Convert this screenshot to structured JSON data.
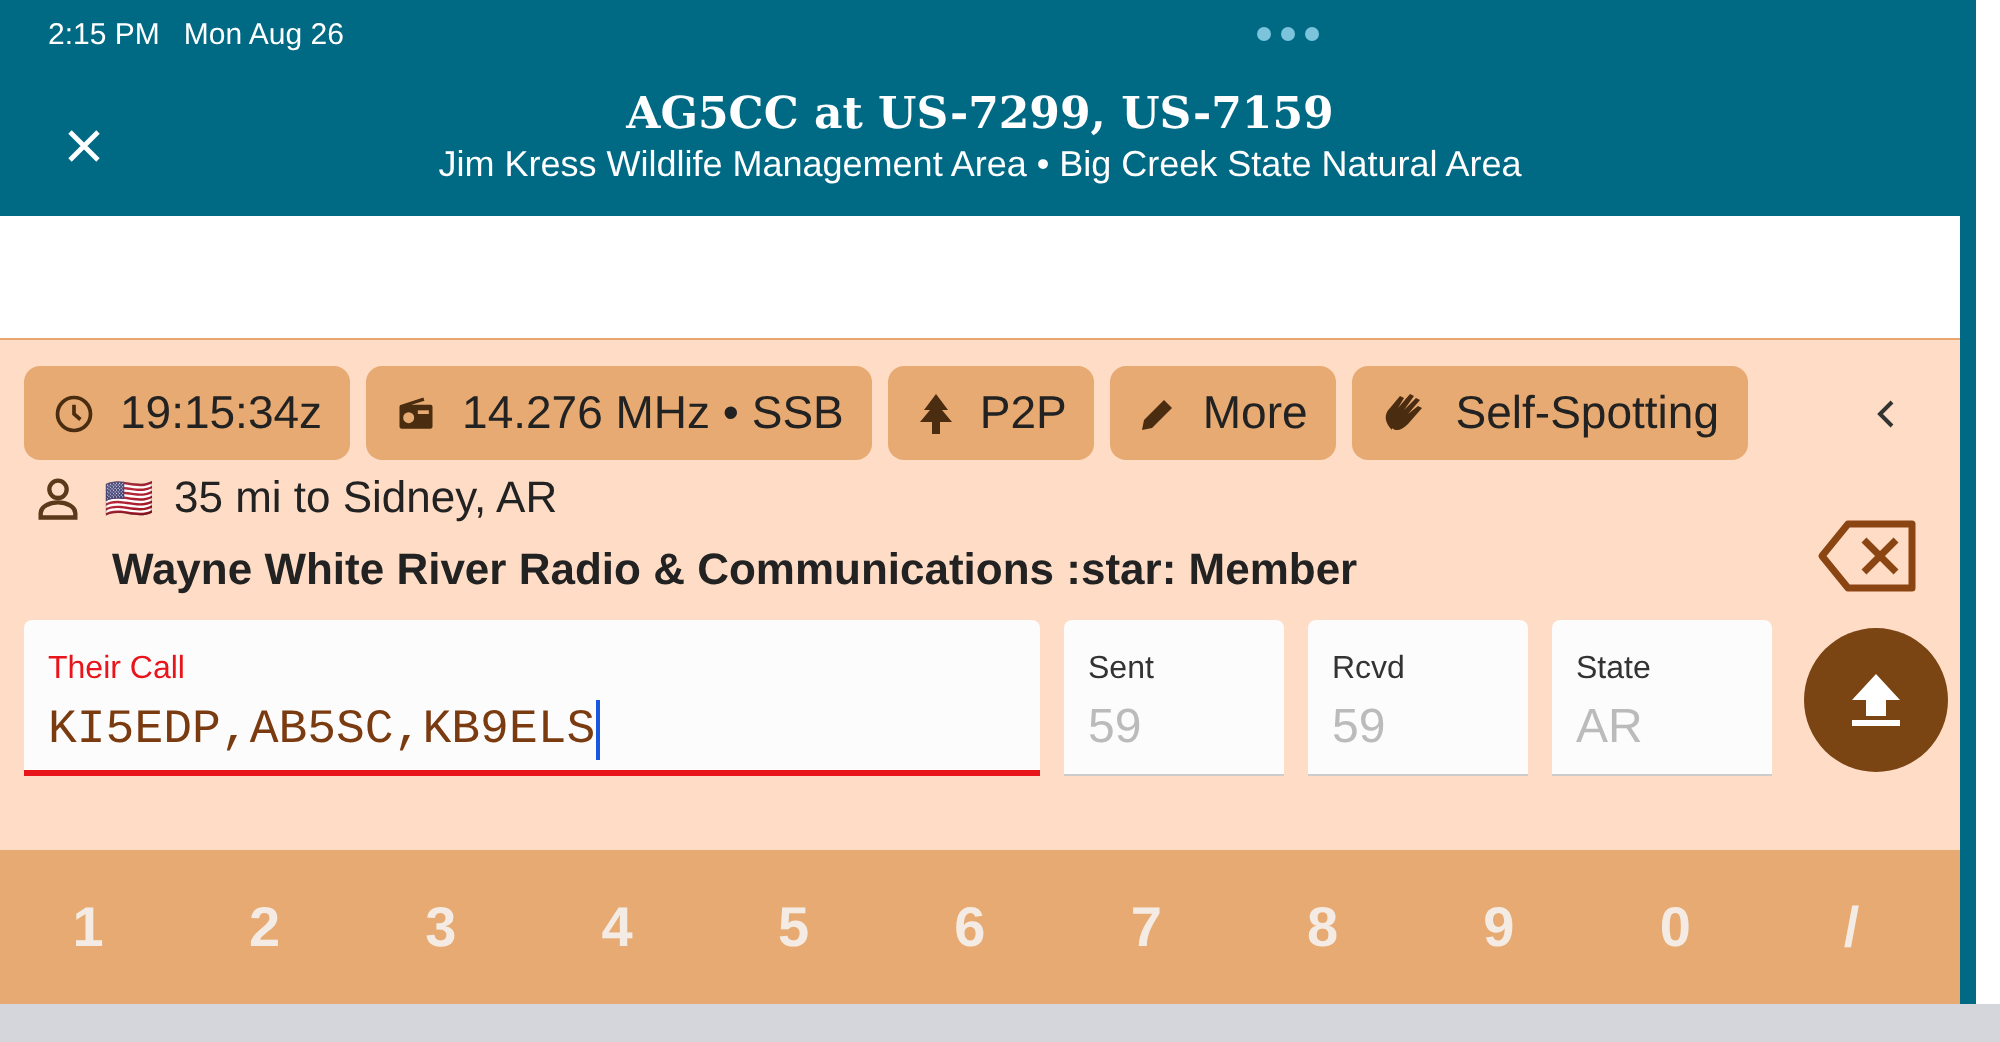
{
  "status_bar": {
    "time": "2:15 PM",
    "date": "Mon Aug 26"
  },
  "header": {
    "title": "AG5CC at US-7299, US-7159",
    "subtitle": "Jim Kress Wildlife Management Area • Big Creek State Natural Area"
  },
  "chips": [
    {
      "label": "19:15:34z"
    },
    {
      "label": "14.276 MHz • SSB"
    },
    {
      "label": "P2P"
    },
    {
      "label": "More"
    },
    {
      "label": "Self-Spotting"
    }
  ],
  "info": {
    "flag": "🇺🇸",
    "distance": "35 mi to Sidney, AR",
    "name": "Wayne White River Radio & Communications :star: Member"
  },
  "fields": [
    {
      "label": "Their Call",
      "value": "KI5EDP,AB5SC,KB9ELS",
      "focused": true
    },
    {
      "label": "Sent",
      "placeholder": "59",
      "focused": false
    },
    {
      "label": "Rcvd",
      "placeholder": "59",
      "focused": false
    },
    {
      "label": "State",
      "placeholder": "AR",
      "focused": false
    }
  ],
  "keys": [
    "1",
    "2",
    "3",
    "4",
    "5",
    "6",
    "7",
    "8",
    "9",
    "0",
    "/"
  ]
}
